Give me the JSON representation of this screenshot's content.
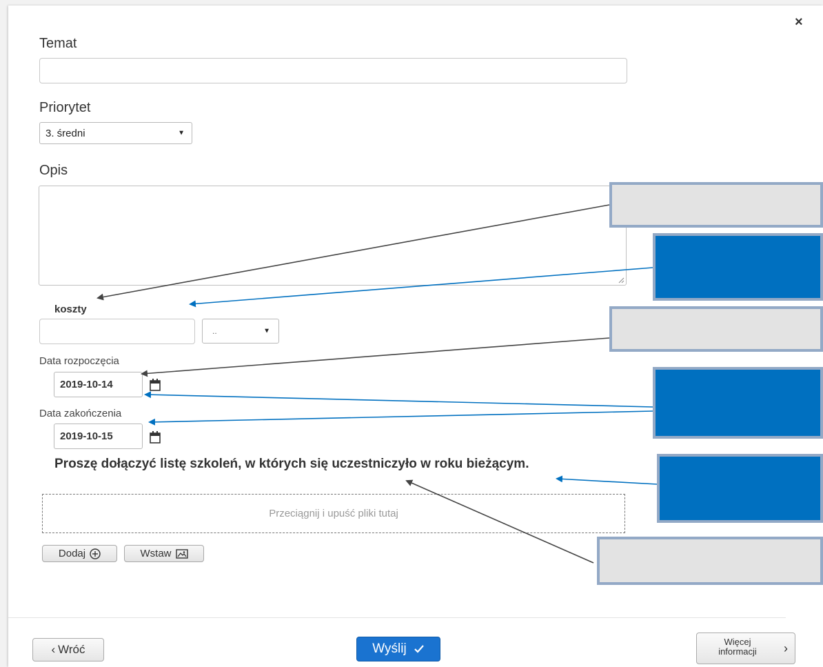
{
  "dialog": {
    "close_label": "×"
  },
  "form": {
    "subject": {
      "label": "Temat",
      "value": ""
    },
    "priority": {
      "label": "Priorytet",
      "selected": "3. średni"
    },
    "description": {
      "label": "Opis",
      "value": ""
    },
    "costs": {
      "label": "koszty",
      "value": "",
      "currency_selected": ".."
    },
    "start_date": {
      "label": "Data rozpoczęcia",
      "value": "2019-10-14"
    },
    "end_date": {
      "label": "Data zakończenia",
      "value": "2019-10-15"
    },
    "instruction": "Proszę dołączyć listę szkoleń, w których się uczestniczyło w roku bieżącym.",
    "dropzone_text": "Przeciągnij i upuść pliki tutaj",
    "add_button": "Dodaj",
    "insert_button": "Wstaw"
  },
  "footer": {
    "back_label": "Wróć",
    "send_label": "Wyślij",
    "more_label_line1": "Więcej",
    "more_label_line2": "informacji"
  },
  "icons": {
    "close": "close-icon",
    "dropdown": "caret-down-icon",
    "calendar": "calendar-icon",
    "add": "plus-circle-icon",
    "insert": "image-icon",
    "back": "chevron-left-icon",
    "send": "checkmark-icon",
    "more": "chevron-right-icon"
  },
  "colors": {
    "primary_button": "#1a73d0",
    "callout_blue": "#0070c0",
    "callout_grey": "#e3e3e3",
    "callout_border": "#93a9c6",
    "arrow_dark": "#444444",
    "arrow_blue": "#0070c0"
  }
}
